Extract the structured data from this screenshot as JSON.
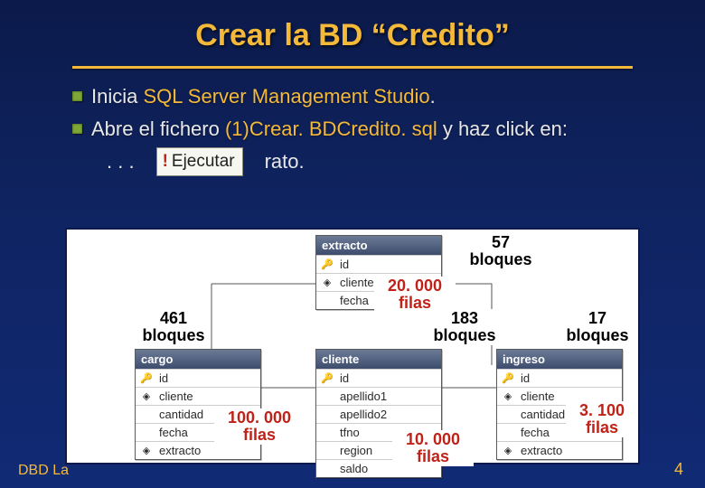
{
  "title": "Crear la BD “Credito”",
  "bullets": {
    "b1_pre": "Inicia",
    "b1_hl": " SQL Server Management Studio",
    "b1_post": ".",
    "b2_pre": "Abre el fichero",
    "b2_hl": " (1)Crear. BDCredito. sql",
    "b2_post": " y haz click en:",
    "dots": ". . .",
    "rato": " rato."
  },
  "exec": {
    "bang": "!",
    "label": "Ejecutar"
  },
  "labels": {
    "bloques57": "57\nbloques",
    "filas20k": "20. 000\nfilas",
    "bloques461": "461\nbloques",
    "bloques183": "183\nbloques",
    "bloques17": "17\nbloques",
    "filas100k": "100. 000\nfilas",
    "filas10k": "10. 000\nfilas",
    "filas3100": "3. 100\nfilas"
  },
  "tables": {
    "extracto": {
      "name": "extracto",
      "cols": [
        "id",
        "cliente",
        "fecha"
      ]
    },
    "cargo": {
      "name": "cargo",
      "cols": [
        "id",
        "cliente",
        "cantidad",
        "fecha",
        "extracto"
      ]
    },
    "cliente": {
      "name": "cliente",
      "cols": [
        "id",
        "apellido1",
        "apellido2",
        "tfno",
        "region",
        "saldo"
      ]
    },
    "ingreso": {
      "name": "ingreso",
      "cols": [
        "id",
        "cliente",
        "cantidad",
        "fecha",
        "extracto"
      ]
    }
  },
  "footer": {
    "left": "DBD  La",
    "right": "4"
  }
}
